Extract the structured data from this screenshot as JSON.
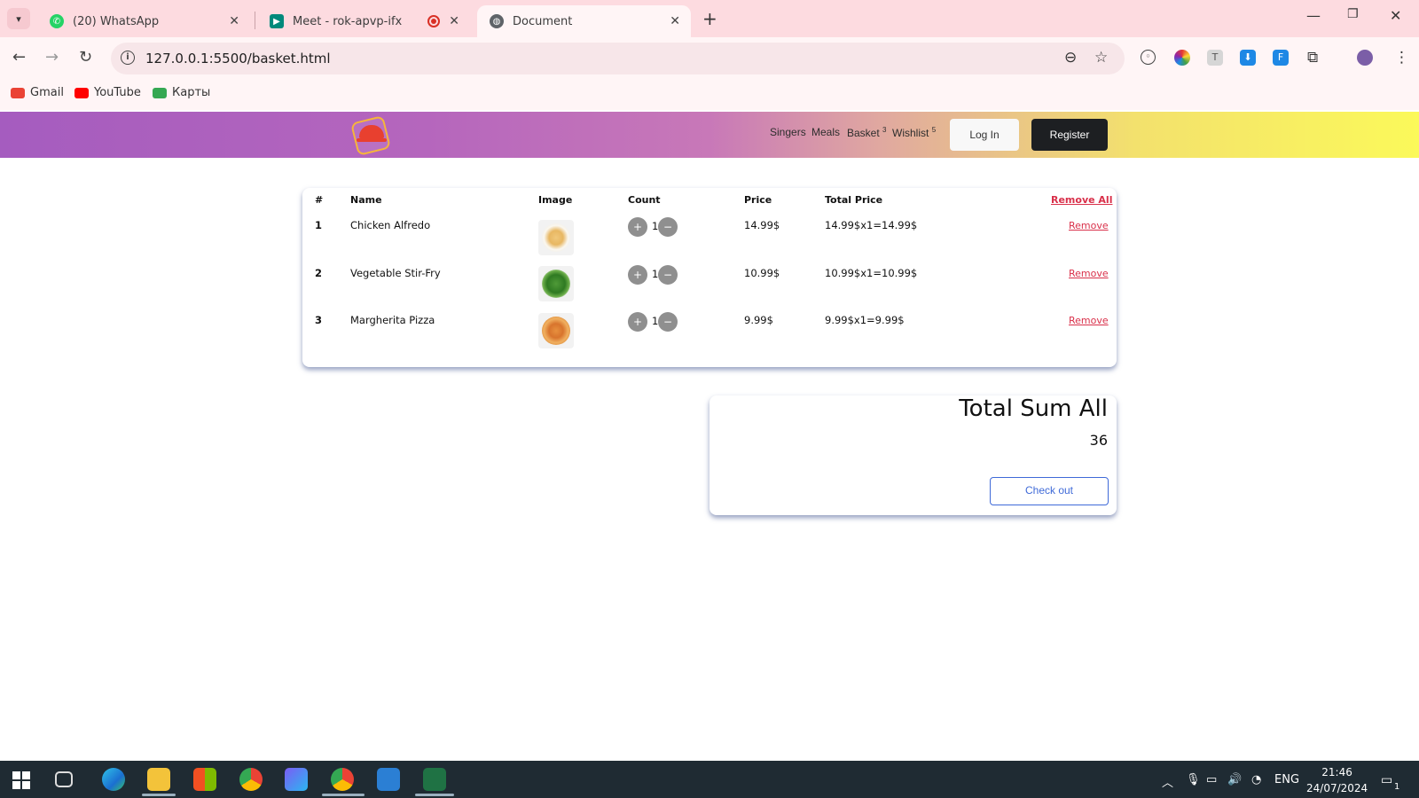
{
  "browser": {
    "tabs": [
      {
        "title": "(20) WhatsApp",
        "active": false
      },
      {
        "title": "Meet - rok-apvp-ifx",
        "active": false
      },
      {
        "title": "Document",
        "active": true
      }
    ],
    "url": "127.0.0.1:5500/basket.html",
    "bookmarks": [
      "Gmail",
      "YouTube",
      "Карты"
    ]
  },
  "site": {
    "nav": [
      {
        "label": "Singers",
        "badge": ""
      },
      {
        "label": "Meals",
        "badge": ""
      },
      {
        "label": "Basket",
        "badge": "3"
      },
      {
        "label": "Wishlist",
        "badge": "5"
      }
    ],
    "login_label": "Log In",
    "register_label": "Register"
  },
  "basket": {
    "headers": {
      "index": "#",
      "name": "Name",
      "image": "Image",
      "count": "Count",
      "price": "Price",
      "total": "Total Price"
    },
    "remove_all_label": "Remove  All",
    "plus_label": "+",
    "minus_label": "−",
    "remove_label": "Remove",
    "rows": [
      {
        "index": "1",
        "name": "Chicken Alfredo",
        "image": "pasta-dish-icon",
        "count": "1",
        "price": "14.99$",
        "total": "14.99$x1=14.99$"
      },
      {
        "index": "2",
        "name": "Vegetable Stir-Fry",
        "image": "vegetable-dish-icon",
        "count": "1",
        "price": "10.99$",
        "total": "10.99$x1=10.99$"
      },
      {
        "index": "3",
        "name": "Margherita Pizza",
        "image": "pizza-icon",
        "count": "1",
        "price": "9.99$",
        "total": "9.99$x1=9.99$"
      }
    ]
  },
  "summary": {
    "title": "Total Sum All",
    "value": "36",
    "checkout_label": "Check out"
  },
  "taskbar": {
    "language": "ENG",
    "time": "21:46",
    "date": "24/07/2024",
    "notifications": "1"
  },
  "colors": {
    "danger": "#d9304a",
    "primary": "#3f6ad8",
    "header_gradient_start": "#a55cbf",
    "header_gradient_end": "#fbf95a"
  }
}
